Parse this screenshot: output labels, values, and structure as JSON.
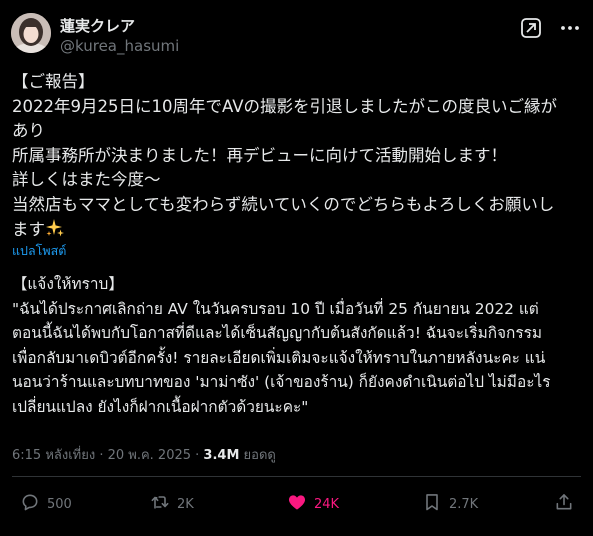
{
  "author": {
    "display_name": "蓮実クレア",
    "handle": "@kurea_hasumi"
  },
  "tweet": {
    "lines": [
      "【ご報告】",
      "2022年9月25日に10周年でAVの撮影を引退しましたがこの度良いご縁が",
      "あり",
      "所属事務所が決まりました！再デビューに向けて活動開始します！",
      "詳しくはまた今度〜",
      "当然店もママとしても変わらず続いていくのでどちらもよろしくお願いし",
      "ます"
    ],
    "emoji": "sparkles"
  },
  "translate_link": "แปลโพสต์",
  "translation": {
    "lines": [
      "【แจ้งให้ทราบ】",
      "\"ฉันได้ประกาศเลิกถ่าย AV ในวันครบรอบ 10 ปี เมื่อวันที่ 25 กันยายน 2022 แต่",
      "ตอนนี้ฉันได้พบกับโอกาสที่ดีและได้เซ็นสัญญากับต้นสังกัดแล้ว! ฉันจะเริ่มกิจกรรม",
      "เพื่อกลับมาเดบิวต์อีกครั้ง! รายละเอียดเพิ่มเติมจะแจ้งให้ทราบในภายหลังนะคะ แน่",
      "นอนว่าร้านและบทบาทของ 'มาม่าซัง' (เจ้าของร้าน) ก็ยังคงดำเนินต่อไป ไม่มีอะไร",
      "เปลี่ยนแปลง ยังไงก็ฝากเนื้อฝากตัวด้วยนะคะ\""
    ]
  },
  "meta": {
    "time": "6:15 หลังเที่ยง",
    "separator": " · ",
    "date": "20 พ.ค. 2025",
    "views_count": "3.4M",
    "views_label": "ยอดดู"
  },
  "actions": {
    "replies": "500",
    "reposts": "2K",
    "likes": "24K",
    "bookmarks": "2.7K"
  },
  "colors": {
    "background": "#000000",
    "text": "#e7e9ea",
    "muted": "#71767b",
    "link": "#1d9bf0",
    "like": "#f91880",
    "divider": "#2f3336"
  },
  "icons": [
    "grok-icon",
    "more-icon",
    "reply-icon",
    "repost-icon",
    "heart-icon",
    "bookmark-icon",
    "share-icon",
    "sparkles-emoji"
  ]
}
